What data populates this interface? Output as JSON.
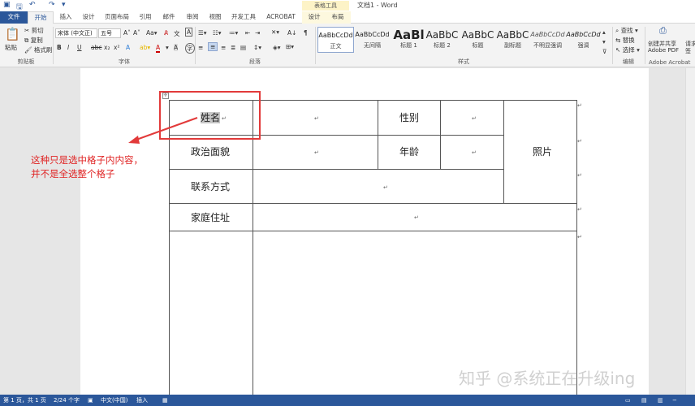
{
  "titlebar": {
    "context_group": "表格工具",
    "doc_title": "文档1 - Word"
  },
  "tabs": [
    "文件",
    "开始",
    "插入",
    "设计",
    "页面布局",
    "引用",
    "邮件",
    "审阅",
    "视图",
    "开发工具",
    "ACROBAT",
    "设计",
    "布局"
  ],
  "ribbon": {
    "clipboard": {
      "paste": "粘贴",
      "cut": "剪切",
      "copy": "复制",
      "format_painter": "格式刷",
      "label": "剪贴板"
    },
    "font": {
      "font_name": "宋体 (中文正)",
      "font_size": "五号",
      "label": "字体"
    },
    "paragraph": {
      "label": "段落"
    },
    "styles": {
      "label": "样式",
      "items": [
        {
          "sample": "AaBbCcDd",
          "name": "正文"
        },
        {
          "sample": "AaBbCcDd",
          "name": "无间隔"
        },
        {
          "sample": "AaBl",
          "name": "标题 1"
        },
        {
          "sample": "AaBbC",
          "name": "标题 2"
        },
        {
          "sample": "AaBbC",
          "name": "标题"
        },
        {
          "sample": "AaBbC",
          "name": "副标题"
        },
        {
          "sample": "AaBbCcDd",
          "name": "不明显强调"
        },
        {
          "sample": "AaBbCcDd",
          "name": "强调"
        }
      ]
    },
    "editing": {
      "find": "查找",
      "replace": "替换",
      "select": "选择",
      "label": "编辑"
    },
    "acrobat": {
      "create_line1": "创建并共享",
      "create_line2": "Adobe PDF",
      "request": "请求",
      "request2": "签",
      "label": "Adobe Acrobat"
    }
  },
  "table": {
    "name": "姓名",
    "gender": "性别",
    "political": "政治面貌",
    "age": "年龄",
    "photo": "照片",
    "contact": "联系方式",
    "address": "家庭住址"
  },
  "annotation": {
    "line1": "这种只是选中格子内内容，",
    "line2": "并不是全选整个格子"
  },
  "watermark": "知乎 @系统正在升级ing",
  "status": {
    "page": "第 1 页，共 1 页",
    "words": "2/24 个字",
    "language": "中文(中国)",
    "mode": "插入"
  }
}
